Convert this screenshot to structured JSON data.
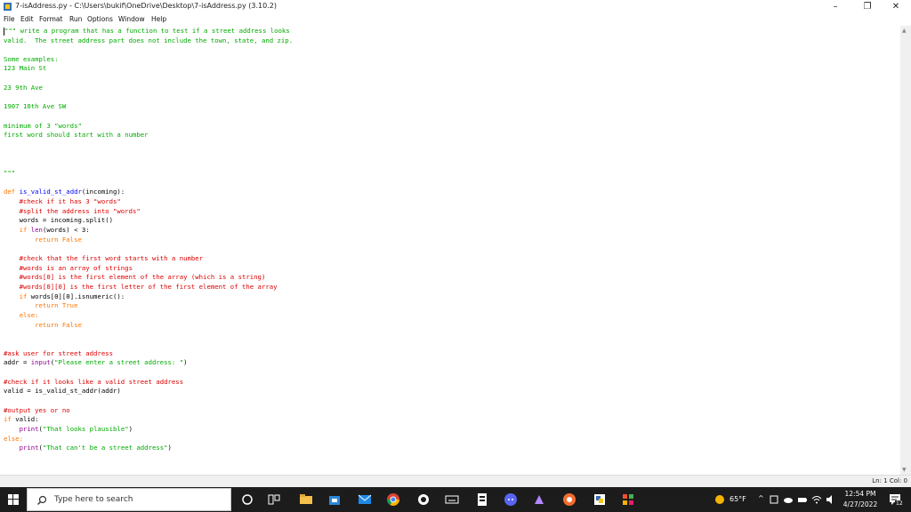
{
  "window": {
    "title": "7-isAddress.py - C:\\Users\\bukif\\OneDrive\\Desktop\\7-isAddress.py (3.10.2)",
    "minimize": "–",
    "maximize": "❐",
    "close": "✕"
  },
  "menu": [
    "File",
    "Edit",
    "Format",
    "Run",
    "Options",
    "Window",
    "Help"
  ],
  "code": {
    "l1a": "\"\"\" write a program that has a function to test if a street address looks",
    "l2": "valid.  The street address part does not include the town, state, and zip.",
    "l3": "Some examples:",
    "l4": "123 Main St",
    "l5": "23 9th Ave",
    "l6": "1907 10th Ave SW",
    "l7": "minimum of 3 \"words\"",
    "l8": "first word should start with a number",
    "l9": "\"\"\"",
    "def_kw": "def ",
    "def_name": "is_valid_st_addr",
    "def_rest": "(incoming):",
    "c1": "    #check if it has 3 \"words\"",
    "c2": "    #split the address into \"words\"",
    "w1": "    words = incoming.split()",
    "if1_kw": "    if ",
    "if1_bi": "len",
    "if1_rest": "(words) < 3:",
    "ret1": "        return False",
    "c3": "    #check that the first word starts with a number",
    "c4": "    #words is an array of strings",
    "c5": "    #words[0] is the first element of the array (which is a string)",
    "c6": "    #words[0][0] is the first letter of the first element of the array",
    "if2_kw": "    if ",
    "if2_rest": "words[0][0].isnumeric():",
    "ret2": "        return True",
    "else1": "    else:",
    "ret3": "        return False",
    "c7": "#ask user for street address",
    "addr_a": "addr = ",
    "addr_bi": "input",
    "addr_b": "(",
    "addr_str": "\"Please enter a street address: \"",
    "addr_c": ")",
    "c8": "#check if it looks like a valid street address",
    "valid": "valid = is_valid_st_addr(addr)",
    "c9": "#output yes or no",
    "if3_kw": "if ",
    "if3_rest": "valid:",
    "p1_a": "    ",
    "p1_bi": "print",
    "p1_b": "(",
    "p1_str": "\"That looks plausible\"",
    "p1_c": ")",
    "else2": "else:",
    "p2_a": "    ",
    "p2_bi": "print",
    "p2_b": "(",
    "p2_str": "\"That can't be a street address\"",
    "p2_c": ")"
  },
  "status": {
    "position": "Ln: 1   Col: 0"
  },
  "taskbar": {
    "search_placeholder": "Type here to search",
    "weather": "65°F",
    "time": "12:54 PM",
    "date": "4/27/2022",
    "notifications": "12",
    "icons": [
      "windows-start-icon",
      "cortana-icon",
      "task-view-icon",
      "file-explorer-icon",
      "store-icon",
      "mail-icon",
      "chrome-icon",
      "steam-icon",
      "keyboard-icon",
      "epic-games-icon",
      "discord-icon",
      "app-icon",
      "origin-icon",
      "python-idle-icon",
      "git-icon"
    ]
  },
  "colors": {
    "string": "#00aa00",
    "comment": "#dd0000",
    "keyword": "#ff7700",
    "builtin": "#900090",
    "definition": "#0000ff",
    "taskbar": "#1c1c1c"
  }
}
